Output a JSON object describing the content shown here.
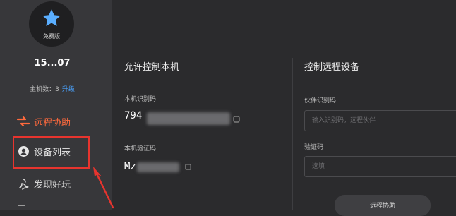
{
  "sidebar": {
    "level_label": "免费版",
    "username": "15...07",
    "host_count_label": "主机数：3",
    "upgrade_link": "升级",
    "items": [
      {
        "label": "远程协助",
        "icon": "remote-assist-icon",
        "active": true
      },
      {
        "label": "设备列表",
        "icon": "device-list-icon",
        "active": false
      },
      {
        "label": "发现好玩",
        "icon": "discover-icon",
        "active": false
      }
    ]
  },
  "allow_control": {
    "title": "允许控制本机",
    "id_label": "本机识别码",
    "id_value": "794",
    "verify_label": "本机验证码",
    "verify_value": "Mz"
  },
  "remote_control": {
    "title": "控制远程设备",
    "partner_id_label": "伙伴识别码",
    "partner_id_placeholder": "输入识别码，远程伙伴",
    "verify_label": "验证码",
    "verify_placeholder": "选填",
    "connect_button": "远程协助"
  },
  "colors": {
    "accent_orange": "#ff6a3d",
    "link_blue": "#4aa3ff",
    "highlight_red": "#e7342e",
    "star_blue": "#5aaeff"
  }
}
